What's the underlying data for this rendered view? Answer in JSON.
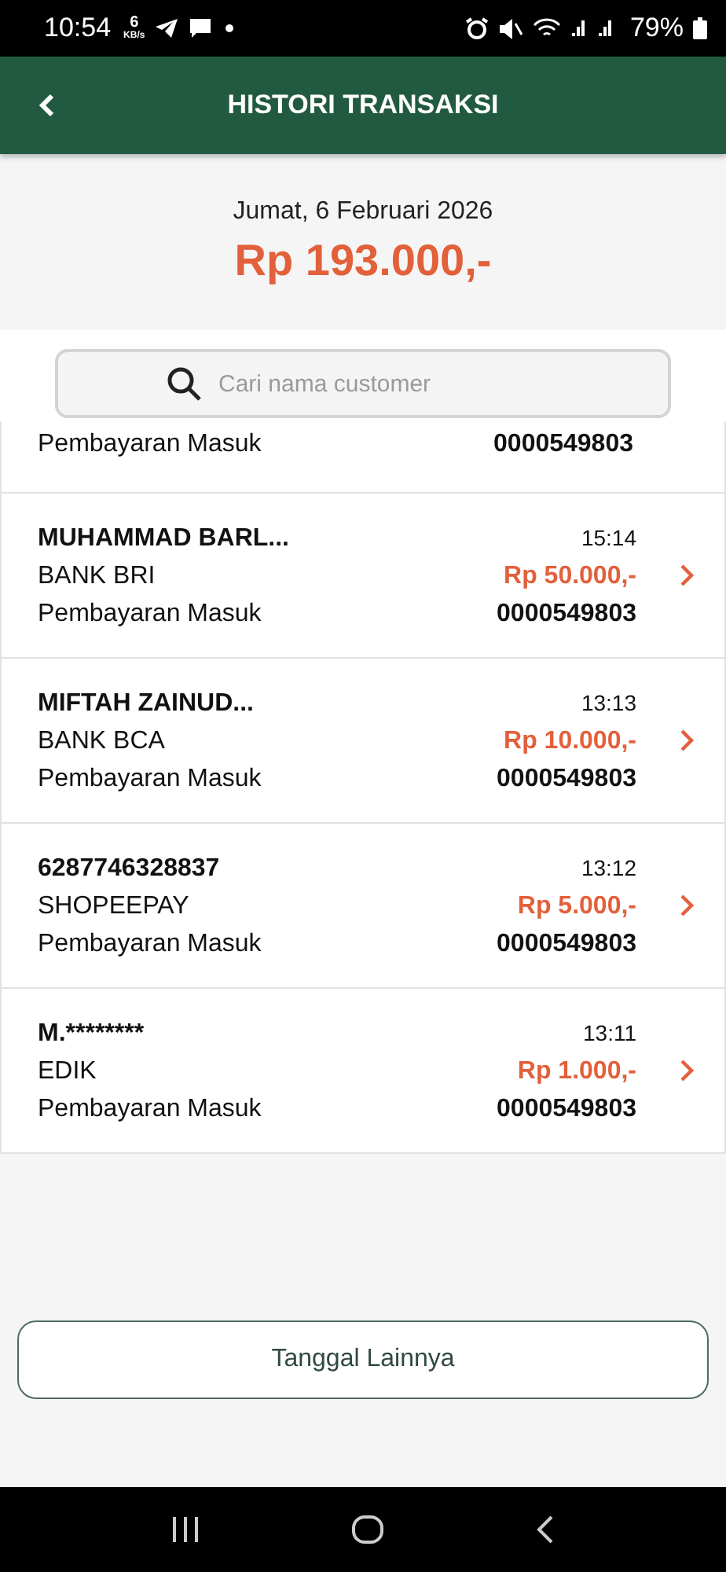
{
  "status_bar": {
    "time": "10:54",
    "speed_value": "6",
    "speed_unit": "KB/s",
    "battery": "79%"
  },
  "header": {
    "title": "HISTORI TRANSAKSI"
  },
  "summary": {
    "date": "Jumat, 6 Februari 2026",
    "total": "Rp 193.000,-"
  },
  "search": {
    "placeholder": "Cari nama customer"
  },
  "partial_row": {
    "type": "Pembayaran Masuk",
    "reference": "0000549803"
  },
  "transactions": [
    {
      "name": "MUHAMMAD BARL...",
      "method": "BANK BRI",
      "type": "Pembayaran Masuk",
      "time": "15:14",
      "amount": "Rp 50.000,-",
      "reference": "0000549803"
    },
    {
      "name": "MIFTAH ZAINUD...",
      "method": "BANK BCA",
      "type": "Pembayaran Masuk",
      "time": "13:13",
      "amount": "Rp 10.000,-",
      "reference": "0000549803"
    },
    {
      "name": "6287746328837",
      "method": "SHOPEEPAY",
      "type": "Pembayaran Masuk",
      "time": "13:12",
      "amount": "Rp 5.000,-",
      "reference": "0000549803"
    },
    {
      "name": "M.********",
      "method": "EDIK",
      "type": "Pembayaran Masuk",
      "time": "13:11",
      "amount": "Rp 1.000,-",
      "reference": "0000549803"
    }
  ],
  "more_button": "Tanggal Lainnya"
}
